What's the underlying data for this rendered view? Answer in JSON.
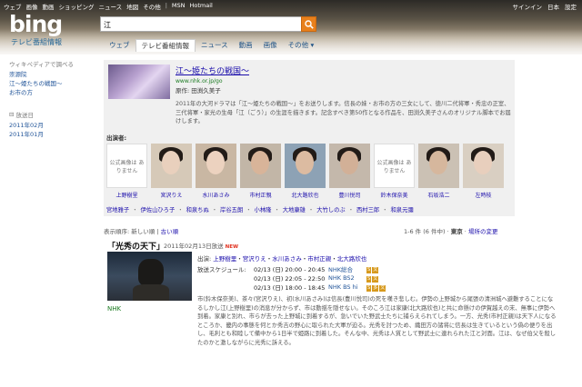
{
  "topnav": [
    "ウェブ",
    "画像",
    "動画",
    "ショッピング",
    "ニュース",
    "地図",
    "その他",
    "MSN",
    "Hotmail"
  ],
  "topright": [
    "サインイン",
    "日本",
    "設定"
  ],
  "logo": {
    "text": "bing",
    "sub": "テレビ番組情報"
  },
  "search": {
    "value": "江"
  },
  "tabs": [
    {
      "label": "ウェブ",
      "active": false
    },
    {
      "label": "テレビ番組情報",
      "active": true
    },
    {
      "label": "ニュース",
      "active": false
    },
    {
      "label": "動画",
      "active": false
    },
    {
      "label": "画像",
      "active": false
    },
    {
      "label": "その他 ▾",
      "active": false
    }
  ],
  "sidebar": {
    "wiki_title": "ウィキペディアで調べる",
    "wiki_links": [
      "崇源院",
      "江〜姫たちの戦国〜",
      "お市の方"
    ],
    "history_title": "放送日",
    "history_links": [
      "2011年02月",
      "2011年01月"
    ]
  },
  "card": {
    "title": "江〜姫たちの戦国〜",
    "url": "www.nhk.or.jp/go",
    "original": "原作: 田渕久美子",
    "description": "2011年の大河ドラマは「江〜姫たちの戦国〜」をお送りします。信長の妹・お市の方の三女にして、徳川二代将軍・秀忠の正室、三代将軍・家光の生母「江（ごう）」の生涯を描きます。記念すべき第50作となる作品を、田渕久美子さんのオリジナル脚本でお届けします。",
    "cast_heading": "出演者:",
    "cast": [
      {
        "name": "上野樹里",
        "photo": false,
        "na": "公式画像は ありません"
      },
      {
        "name": "宮沢りえ",
        "photo": true,
        "skin": "#e9d0bd",
        "bg": "#d6c9b8"
      },
      {
        "name": "水川あさみ",
        "photo": true,
        "skin": "#ecd2bf",
        "bg": "#c9b7a3"
      },
      {
        "name": "市村正親",
        "photo": true,
        "skin": "#d8b499",
        "bg": "#c2b6a7"
      },
      {
        "name": "北大路欣也",
        "photo": true,
        "skin": "#dcbba1",
        "bg": "#8da2b5"
      },
      {
        "name": "豊川悦司",
        "photo": true,
        "skin": "#d2b097",
        "bg": "#c4b8ab"
      },
      {
        "name": "鈴木保奈美",
        "photo": false,
        "na": "公式画像は ありません"
      },
      {
        "name": "石坂浩二",
        "photo": true,
        "skin": "#d6b79d",
        "bg": "#cbc1b4"
      },
      {
        "name": "左時枝",
        "photo": true,
        "skin": "#e8cfbd",
        "bg": "#d9cfc2"
      }
    ],
    "cast_more": [
      "宮地雅子",
      "伊佐山ひろ子",
      "和泉ちぬ",
      "岸谷五朗",
      "小林隆",
      "大地康雄",
      "大竹しのぶ",
      "西村三郎",
      "和泉元彌"
    ]
  },
  "sort": {
    "label": "表示順序:",
    "new": "新しい順",
    "old": "古い順"
  },
  "results": {
    "count": "1-6 件 (6 件中)",
    "location": "東京",
    "change": "場所の変更"
  },
  "program": {
    "title": "「光秀の天下」",
    "date": "2011年02月13日放送",
    "new_badge": "NEW",
    "channel": "NHK",
    "cast_label": "出演:",
    "cast": [
      "上野樹里",
      "宮沢りえ",
      "水川あさみ",
      "市村正親",
      "北大路欣也"
    ],
    "schedule_label": "放送スケジュール:",
    "schedule": [
      {
        "time": "02/13 (日) 20:00 - 20:45",
        "channel": "NHK総合",
        "badges": [
          "S",
          "文"
        ]
      },
      {
        "time": "02/13 (日) 22:05 - 22:50",
        "channel": "NHK BS2",
        "badges": [
          "S",
          "文"
        ]
      },
      {
        "time": "02/13 (日) 18:00 - 18:45",
        "channel": "NHK BS hi",
        "badges": [
          "S",
          "多",
          "文"
        ]
      }
    ],
    "synopsis": "市(鈴木保奈美)、茶々(宮沢りえ)、初(水川あさみ)は信長(豊川悦司)の死を嘆き悲しむ。伊勢の上野城から尾張の清洲城へ避難することになるしかし江(上野樹里)の消息が分からず、市は動揺を隠せない。そのころ江は家康(北大路欣也)と共に命懸けの伊賀越えの末、無事に伊勢へ到着。家康と別れ、市らが去った上野城に到着するが、急いでいた野武士たちに捕らえられてしまう。一方、光秀(市村正親)は天下人になるところか、畿内の事態を何とか秀吉の野心に取られた大軍が迫る。光秀を討つため、織田方の諸将に信長は生きているという偽の便りを出し、毛利とも和睦して備中から1日半で姫路に到着した。そんな中、光秀は人質として野武士に連れられた江と対面。江は、なぜ伯父を殺したのかと激しながらに光秀に訴える。"
  }
}
